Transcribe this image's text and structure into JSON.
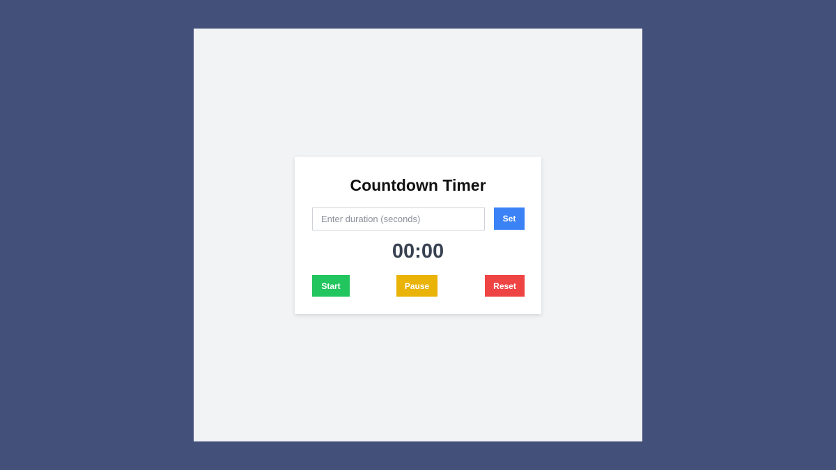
{
  "app": {
    "title": "Countdown Timer"
  },
  "duration": {
    "value": "",
    "placeholder": "Enter duration (seconds)"
  },
  "controls": {
    "set_label": "Set",
    "start_label": "Start",
    "pause_label": "Pause",
    "reset_label": "Reset"
  },
  "timer": {
    "display": "00:00"
  },
  "colors": {
    "page_background": "#43507a",
    "viewport_background": "#f2f3f5",
    "card_background": "#ffffff",
    "set": "#3b82f6",
    "start": "#22c55e",
    "pause": "#eab308",
    "reset": "#ef4444",
    "timer_text": "#374151"
  }
}
